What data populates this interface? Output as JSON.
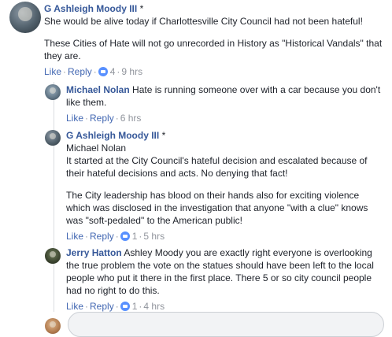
{
  "comments": [
    {
      "author": "G Ashleigh Moody III",
      "marker": "*",
      "paragraphs": [
        "She would be alive today if Charlottesville City Council had not been hateful!",
        "These Cities of Hate will not go unrecorded in History as \"Historical Vandals\" that they are."
      ],
      "like_label": "Like",
      "reply_label": "Reply",
      "reactions": "4",
      "time": "9 hrs"
    },
    {
      "author": "Michael Nolan",
      "text": "Hate is running someone over with a car because you don't like them.",
      "like_label": "Like",
      "reply_label": "Reply",
      "time": "6 hrs"
    },
    {
      "author": "G Ashleigh Moody III",
      "marker": "*",
      "mention": "Michael Nolan",
      "paragraphs": [
        "It started at the City Council's hateful decision and escalated because of their hateful decisions and acts. No denying that fact!",
        "The City leadership has blood on their hands also for exciting violence which was disclosed in the investigation that anyone \"with a clue\" knows was \"soft-pedaled\" to the American public!"
      ],
      "like_label": "Like",
      "reply_label": "Reply",
      "reactions": "1",
      "time": "5 hrs"
    },
    {
      "author": "Jerry Hatton",
      "text": "Ashley Moody you are exactly right everyone is overlooking the true problem the vote on the statues should have been left to the local people who put it there in the first place. There 5 or so city council people had no right to do this.",
      "like_label": "Like",
      "reply_label": "Reply",
      "reactions": "1",
      "time": "4 hrs"
    }
  ],
  "separator": "·",
  "icons": {
    "reaction": "like-icon"
  },
  "colors": {
    "link": "#365899",
    "action": "#4267b2",
    "muted": "#90949c",
    "like_badge": "#5890ff"
  }
}
